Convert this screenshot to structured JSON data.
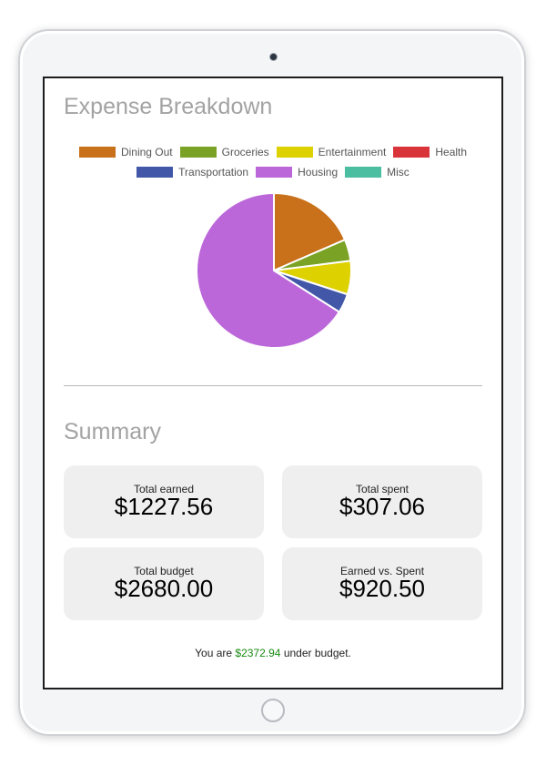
{
  "expense": {
    "title": "Expense Breakdown"
  },
  "legend": [
    {
      "label": "Dining Out",
      "color": "#c8701a"
    },
    {
      "label": "Groceries",
      "color": "#7aa224"
    },
    {
      "label": "Entertainment",
      "color": "#ddd100"
    },
    {
      "label": "Health",
      "color": "#d9343a"
    },
    {
      "label": "Transportation",
      "color": "#4257a8"
    },
    {
      "label": "Housing",
      "color": "#bb67da"
    },
    {
      "label": "Misc",
      "color": "#4bbda0"
    }
  ],
  "chart_data": {
    "type": "pie",
    "title": "",
    "categories": [
      "Dining Out",
      "Groceries",
      "Entertainment",
      "Health",
      "Transportation",
      "Housing",
      "Misc"
    ],
    "values": [
      18.5,
      4.5,
      7.0,
      0,
      4.0,
      66.0,
      0
    ],
    "colors": [
      "#c8701a",
      "#7aa224",
      "#ddd100",
      "#d9343a",
      "#4257a8",
      "#bb67da",
      "#4bbda0"
    ],
    "legend_position": "top"
  },
  "summary": {
    "title": "Summary",
    "cards": [
      {
        "label": "Total earned",
        "value": "$1227.56"
      },
      {
        "label": "Total spent",
        "value": "$307.06"
      },
      {
        "label": "Total budget",
        "value": "$2680.00"
      },
      {
        "label": "Earned vs. Spent",
        "value": "$920.50"
      }
    ],
    "footer_prefix": "You are",
    "footer_amount": "$2372.94",
    "footer_suffix": "under budget."
  }
}
